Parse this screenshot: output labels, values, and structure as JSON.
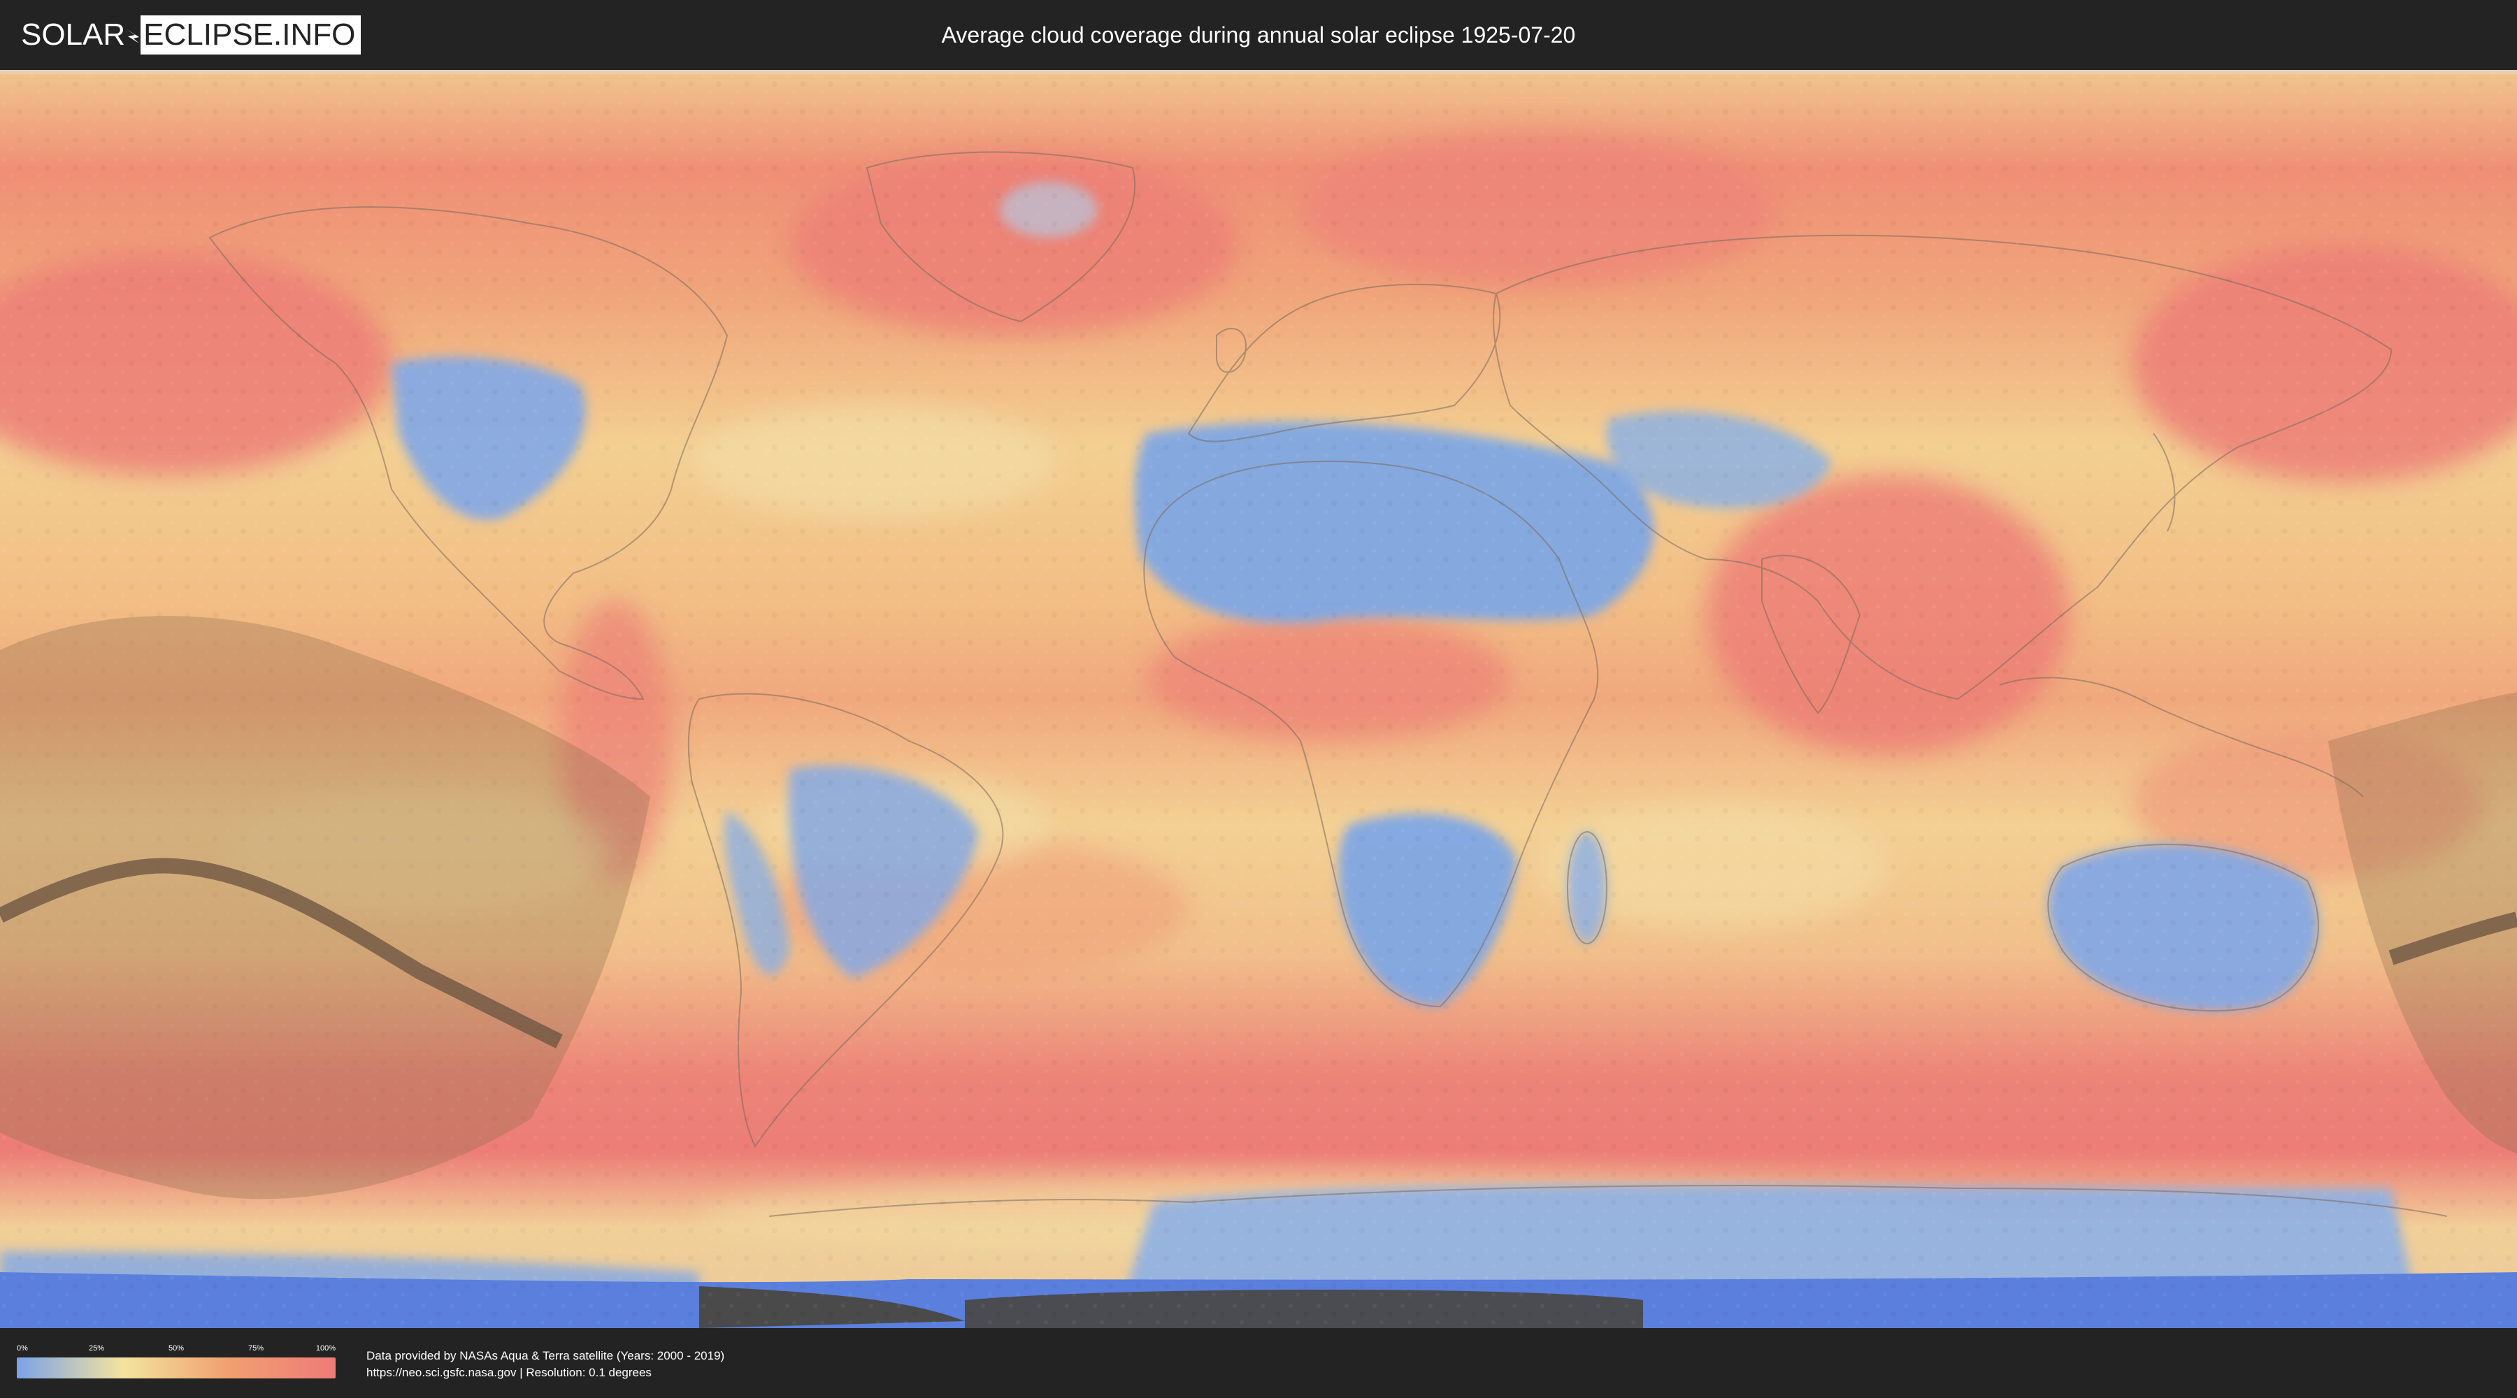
{
  "header": {
    "logo_left": "SOLAR",
    "logo_right": "ECLIPSE.INFO",
    "title": "Average cloud coverage during annual solar eclipse 1925-07-20"
  },
  "legend": {
    "ticks": [
      "0%",
      "25%",
      "50%",
      "75%",
      "100%"
    ],
    "colors": [
      "#7aa3e6",
      "#f4e3a0",
      "#f0a070",
      "#ef7a78"
    ]
  },
  "footer": {
    "credit_line": "Data provided by NASAs Aqua & Terra satellite (Years: 2000 - 2019)",
    "source_line": "https://neo.sci.gsfc.nasa.gov | Resolution: 0.1 degrees"
  },
  "map": {
    "colors": {
      "clear": "#7ea6e4",
      "light": "#f2e2a2",
      "medium": "#f2b883",
      "heavy": "#ec8279",
      "ocean_base": "#efb07c",
      "eclipse_zone": "#8c6c4c",
      "eclipse_path": "#6e5644",
      "no_data": "#4a4a4a",
      "deep_clear": "#4f74dc"
    }
  }
}
